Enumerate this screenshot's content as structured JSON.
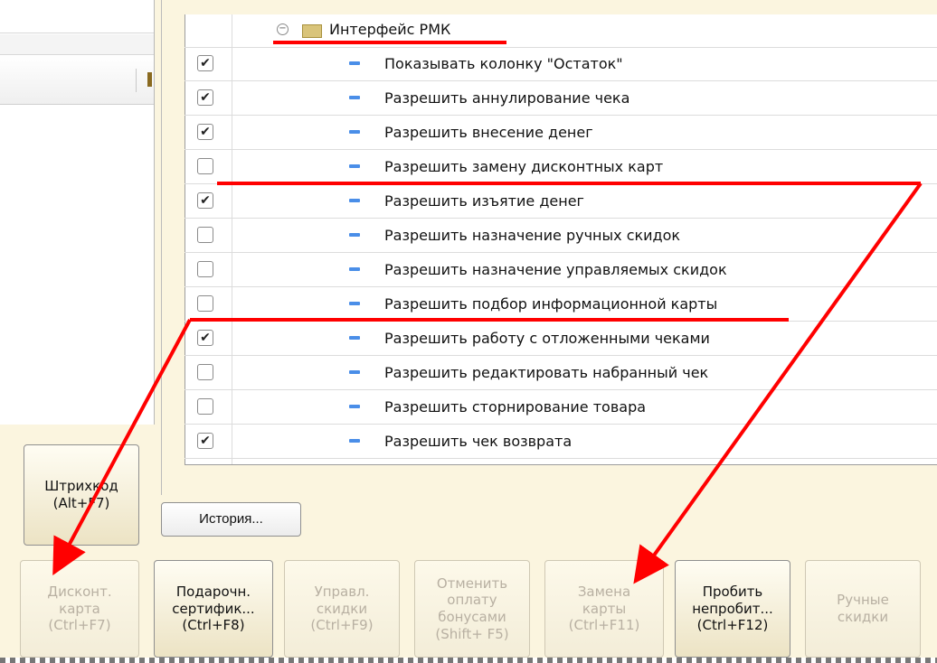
{
  "settings": {
    "group_label": "Интерфейс РМК",
    "rows": [
      {
        "label": "Показывать колонку \"Остаток\"",
        "checked": true
      },
      {
        "label": "Разрешить аннулирование чека",
        "checked": true
      },
      {
        "label": "Разрешить внесение денег",
        "checked": true
      },
      {
        "label": "Разрешить замену дисконтных карт",
        "checked": false
      },
      {
        "label": "Разрешить изъятие денег",
        "checked": true
      },
      {
        "label": "Разрешить назначение ручных скидок",
        "checked": false
      },
      {
        "label": "Разрешить назначение управляемых скидок",
        "checked": false
      },
      {
        "label": "Разрешить подбор информационной карты",
        "checked": false
      },
      {
        "label": "Разрешить работу с отложенными чеками",
        "checked": true
      },
      {
        "label": "Разрешить редактировать набранный чек",
        "checked": false
      },
      {
        "label": "Разрешить сторнирование товара",
        "checked": false
      },
      {
        "label": "Разрешить чек возврата",
        "checked": true
      }
    ]
  },
  "buttons": {
    "history": "История...",
    "barcode": "Штрихкод\n(Alt+F7)",
    "discount_card": "Дисконт.\nкарта\n(Ctrl+F7)",
    "gift_cert": "Подарочн.\nсертифик...\n(Ctrl+F8)",
    "managed_discounts": "Управл.\nскидки\n(Ctrl+F9)",
    "cancel_bonus": "Отменить\nоплату\nбонусами\n(Shift+ F5)",
    "replace_card": "Замена\nкарты\n(Ctrl+F11)",
    "print_unprinted": "Пробить\nнепробит...\n(Ctrl+F12)",
    "manual_discounts": "Ручные\nскидки"
  },
  "colors": {
    "annotation": "#ff0000",
    "checkbox_mark": "✔"
  }
}
